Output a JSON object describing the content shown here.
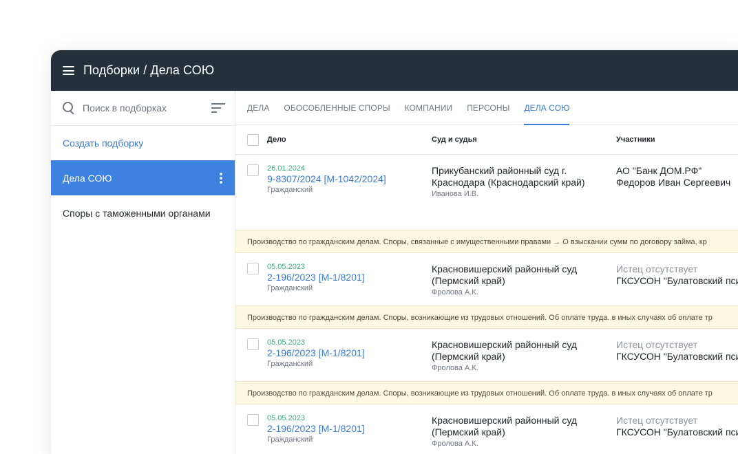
{
  "app": {
    "title": "Подборки / Дела СОЮ"
  },
  "sidebar": {
    "search_placeholder": "Поиск в подборках",
    "create_label": "Создать подборку",
    "items": [
      {
        "label": "Дела СОЮ",
        "active": true
      },
      {
        "label": "Споры с таможенными органами",
        "active": false
      }
    ]
  },
  "tabs": [
    {
      "label": "ДЕЛА",
      "active": false
    },
    {
      "label": "ОБОСОБЛЕННЫЕ СПОРЫ",
      "active": false
    },
    {
      "label": "КОМПАНИИ",
      "active": false
    },
    {
      "label": "ПЕРСОНЫ",
      "active": false
    },
    {
      "label": "ДЕЛА СОЮ",
      "active": true
    }
  ],
  "table": {
    "columns": [
      "Дело",
      "Суд и судья",
      "Участники"
    ],
    "rows": [
      {
        "date": "26.01.2024",
        "number": "9-8307/2024 [М-1042/2024]",
        "type": "Гражданский",
        "court_line1": "Прикубанский районный суд г.",
        "court_line2": "Краснодара (Краснодарский край)",
        "judge": "Иванова И.В.",
        "party1": "АО \"Банк ДОМ.РФ\"",
        "party2": "Федоров Иван Сергеевич",
        "note": "Производство по гражданским делам. Споры, связанные с имущественными правами → О взыскании сумм по договору займа, кр"
      },
      {
        "date": "05.05.2023",
        "number": "2-196/2023 [М-1/8201]",
        "type": "Гражданский",
        "court_line1": "Красновишерский районный суд",
        "court_line2": "(Пермский край)",
        "judge": "Фролова А.К.",
        "party1": "Истец отсутствует",
        "party2": "ГКСУСОН \"Булатовский пси",
        "note": "Производство по гражданским делам. Споры, возникающие из трудовых отношений. Об оплате труда. в иных случаях об оплате тр"
      },
      {
        "date": "05.05.2023",
        "number": "2-196/2023 [М-1/8201]",
        "type": "Гражданский",
        "court_line1": "Красновишерский районный суд",
        "court_line2": "(Пермский край)",
        "judge": "Фролова А.К.",
        "party1": "Истец отсутствует",
        "party2": "ГКСУСОН \"Булатовский пси",
        "note": "Производство по гражданским делам. Споры, возникающие из трудовых отношений. Об оплате труда. в иных случаях об оплате тр"
      },
      {
        "date": "05.05.2023",
        "number": "2-196/2023 [М-1/8201]",
        "type": "Гражданский",
        "court_line1": "Красновишерский районный суд",
        "court_line2": "(Пермский край)",
        "judge": "Фролова А.К.",
        "party1": "Истец отсутствует",
        "party2": "ГКСУСОН \"Булатовский пси",
        "note": ""
      }
    ]
  },
  "colors": {
    "appbar": "#25303b",
    "accent": "#3e82df",
    "link": "#3a7bd5",
    "date": "#39b07a",
    "note_bg": "#fdf8e1"
  }
}
